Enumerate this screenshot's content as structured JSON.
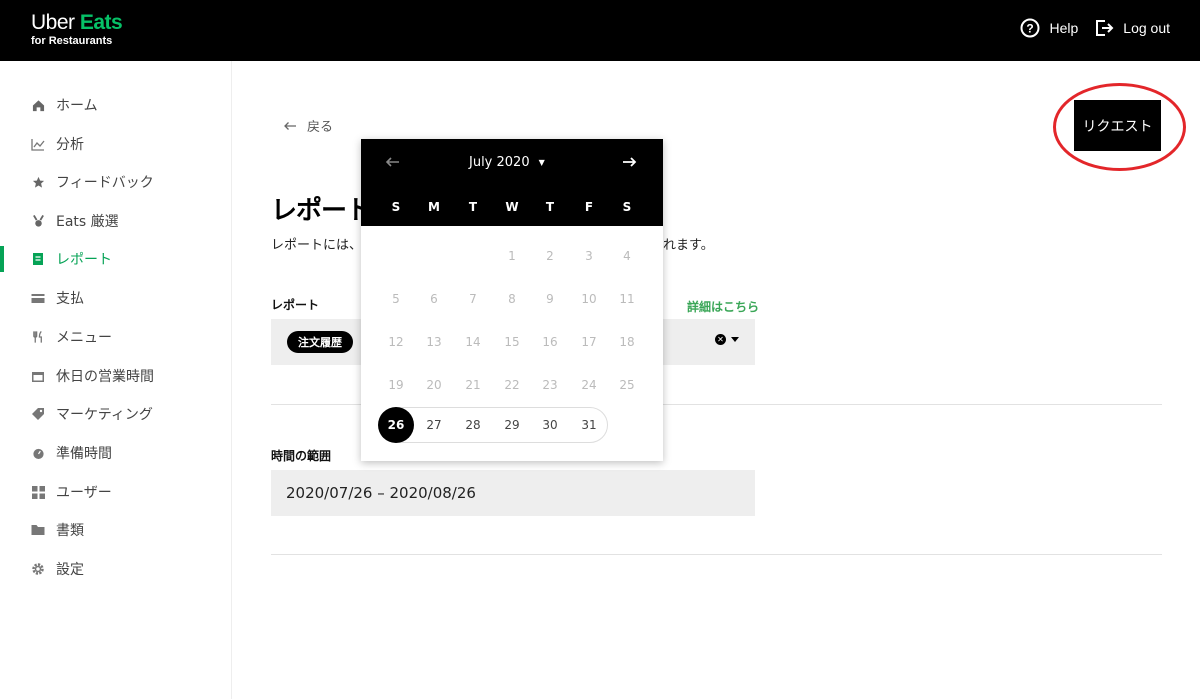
{
  "header": {
    "logo_line1_a": "Uber",
    "logo_line1_b": "Eats",
    "logo_line2": "for Restaurants",
    "help_label": "Help",
    "logout_label": "Log out"
  },
  "sidebar": {
    "items": [
      {
        "label": "ホーム",
        "icon": "home-icon"
      },
      {
        "label": "分析",
        "icon": "chart-icon"
      },
      {
        "label": "フィードバック",
        "icon": "star-icon"
      },
      {
        "label": "Eats 厳選",
        "icon": "medal-icon"
      },
      {
        "label": "レポート",
        "icon": "report-icon",
        "active": true
      },
      {
        "label": "支払",
        "icon": "card-icon"
      },
      {
        "label": "メニュー",
        "icon": "cutlery-icon"
      },
      {
        "label": "休日の営業時間",
        "icon": "calendar-icon"
      },
      {
        "label": "マーケティング",
        "icon": "tag-icon"
      },
      {
        "label": "準備時間",
        "icon": "timer-icon"
      },
      {
        "label": "ユーザー",
        "icon": "users-icon"
      },
      {
        "label": "書類",
        "icon": "folder-icon"
      },
      {
        "label": "設定",
        "icon": "gear-icon"
      }
    ]
  },
  "main": {
    "back_label": "戻る",
    "request_button": "リクエスト",
    "title": "レポートを",
    "description": "レポートには、レ",
    "description_tail": "れます。",
    "report_label": "レポート",
    "details_link": "詳細はこちら",
    "report_chip": "注文履歴",
    "time_range_label": "時間の範囲",
    "date_range_value": "2020/07/26 – 2020/08/26"
  },
  "calendar": {
    "month_label": "July 2020",
    "weekdays": [
      "S",
      "M",
      "T",
      "W",
      "T",
      "F",
      "S"
    ],
    "weeks": [
      [
        "",
        "",
        "",
        "1",
        "2",
        "3",
        "4"
      ],
      [
        "5",
        "6",
        "7",
        "8",
        "9",
        "10",
        "11"
      ],
      [
        "12",
        "13",
        "14",
        "15",
        "16",
        "17",
        "18"
      ],
      [
        "19",
        "20",
        "21",
        "22",
        "23",
        "24",
        "25"
      ],
      [
        "26",
        "27",
        "28",
        "29",
        "30",
        "31",
        ""
      ]
    ],
    "selected_day": "26",
    "range_days": [
      "26",
      "27",
      "28",
      "29",
      "30",
      "31"
    ]
  },
  "colors": {
    "brand_green": "#06c167",
    "active_green": "#06a356",
    "highlight_red": "#e3262a"
  }
}
